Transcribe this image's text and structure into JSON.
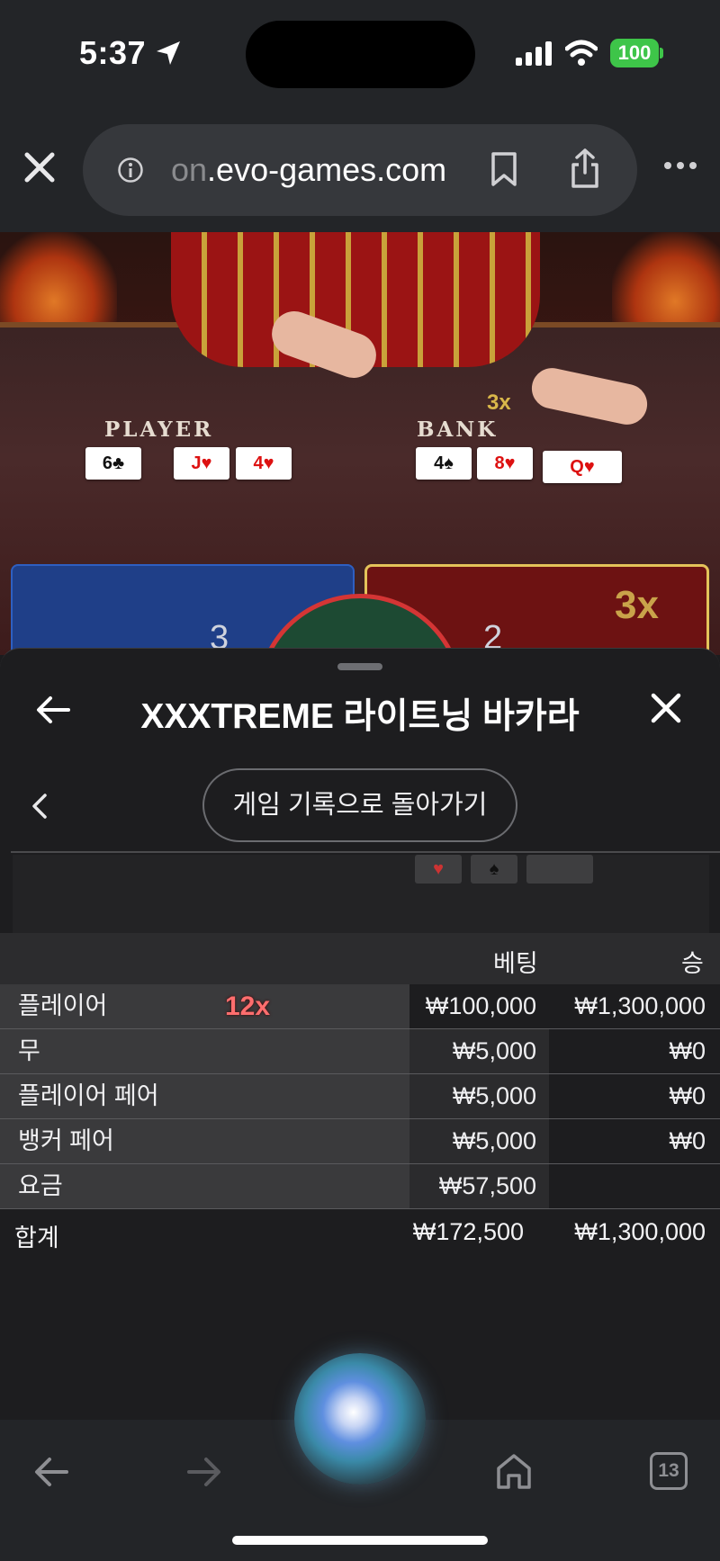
{
  "status_bar": {
    "time": "5:37",
    "battery": "100"
  },
  "browser": {
    "url_faded": "on",
    "url_main": ".evo-games.com"
  },
  "video": {
    "player_label": "PLAYER",
    "banker_label": "BANK",
    "multiplier_small": "3x",
    "player_cards": [
      "6♣",
      "J♥",
      "4♥"
    ],
    "banker_cards": [
      "4♠",
      "8♥",
      "Q♥"
    ],
    "player_score": "3",
    "banker_score": "2",
    "multiplier_big": "3x"
  },
  "sheet": {
    "title": "XXXTREME 라이트닝 바카라",
    "history_button": "게임 기록으로 돌아가기",
    "mini_cards": [
      "♥",
      "♠",
      ""
    ]
  },
  "bets": {
    "headers": {
      "bet": "베팅",
      "win": "승"
    },
    "rows": [
      {
        "name": "플레이어",
        "bet": "₩100,000",
        "win": "₩1,300,000",
        "multiplier": "12x"
      },
      {
        "name": "무",
        "bet": "₩5,000",
        "win": "₩0"
      },
      {
        "name": "플레이어 페어",
        "bet": "₩5,000",
        "win": "₩0"
      },
      {
        "name": "뱅커 페어",
        "bet": "₩5,000",
        "win": "₩0"
      },
      {
        "name": "요금",
        "bet": "₩57,500",
        "win": ""
      }
    ],
    "total": {
      "label": "합계",
      "bet": "₩172,500",
      "win": "₩1,300,000"
    }
  },
  "toolbar": {
    "tab_count": "13"
  }
}
